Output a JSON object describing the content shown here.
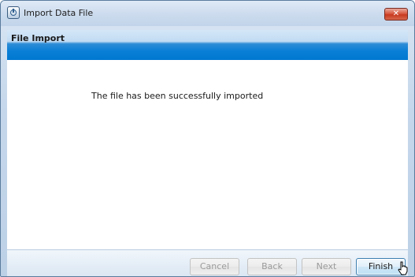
{
  "window": {
    "title": "Import Data File",
    "close_symbol": "✕"
  },
  "header": {
    "title": "File Import"
  },
  "content": {
    "message": "The file has been successfully imported"
  },
  "buttons": {
    "cancel": "Cancel",
    "back": "Back",
    "next": "Next",
    "finish": "Finish"
  },
  "icons": {
    "app": "app-icon",
    "close": "close-icon",
    "cursor": "hand-pointer-cursor-icon"
  },
  "colors": {
    "header_band": "#0078d1",
    "close_button": "#c73a20",
    "finish_border": "#3c7fb1"
  }
}
